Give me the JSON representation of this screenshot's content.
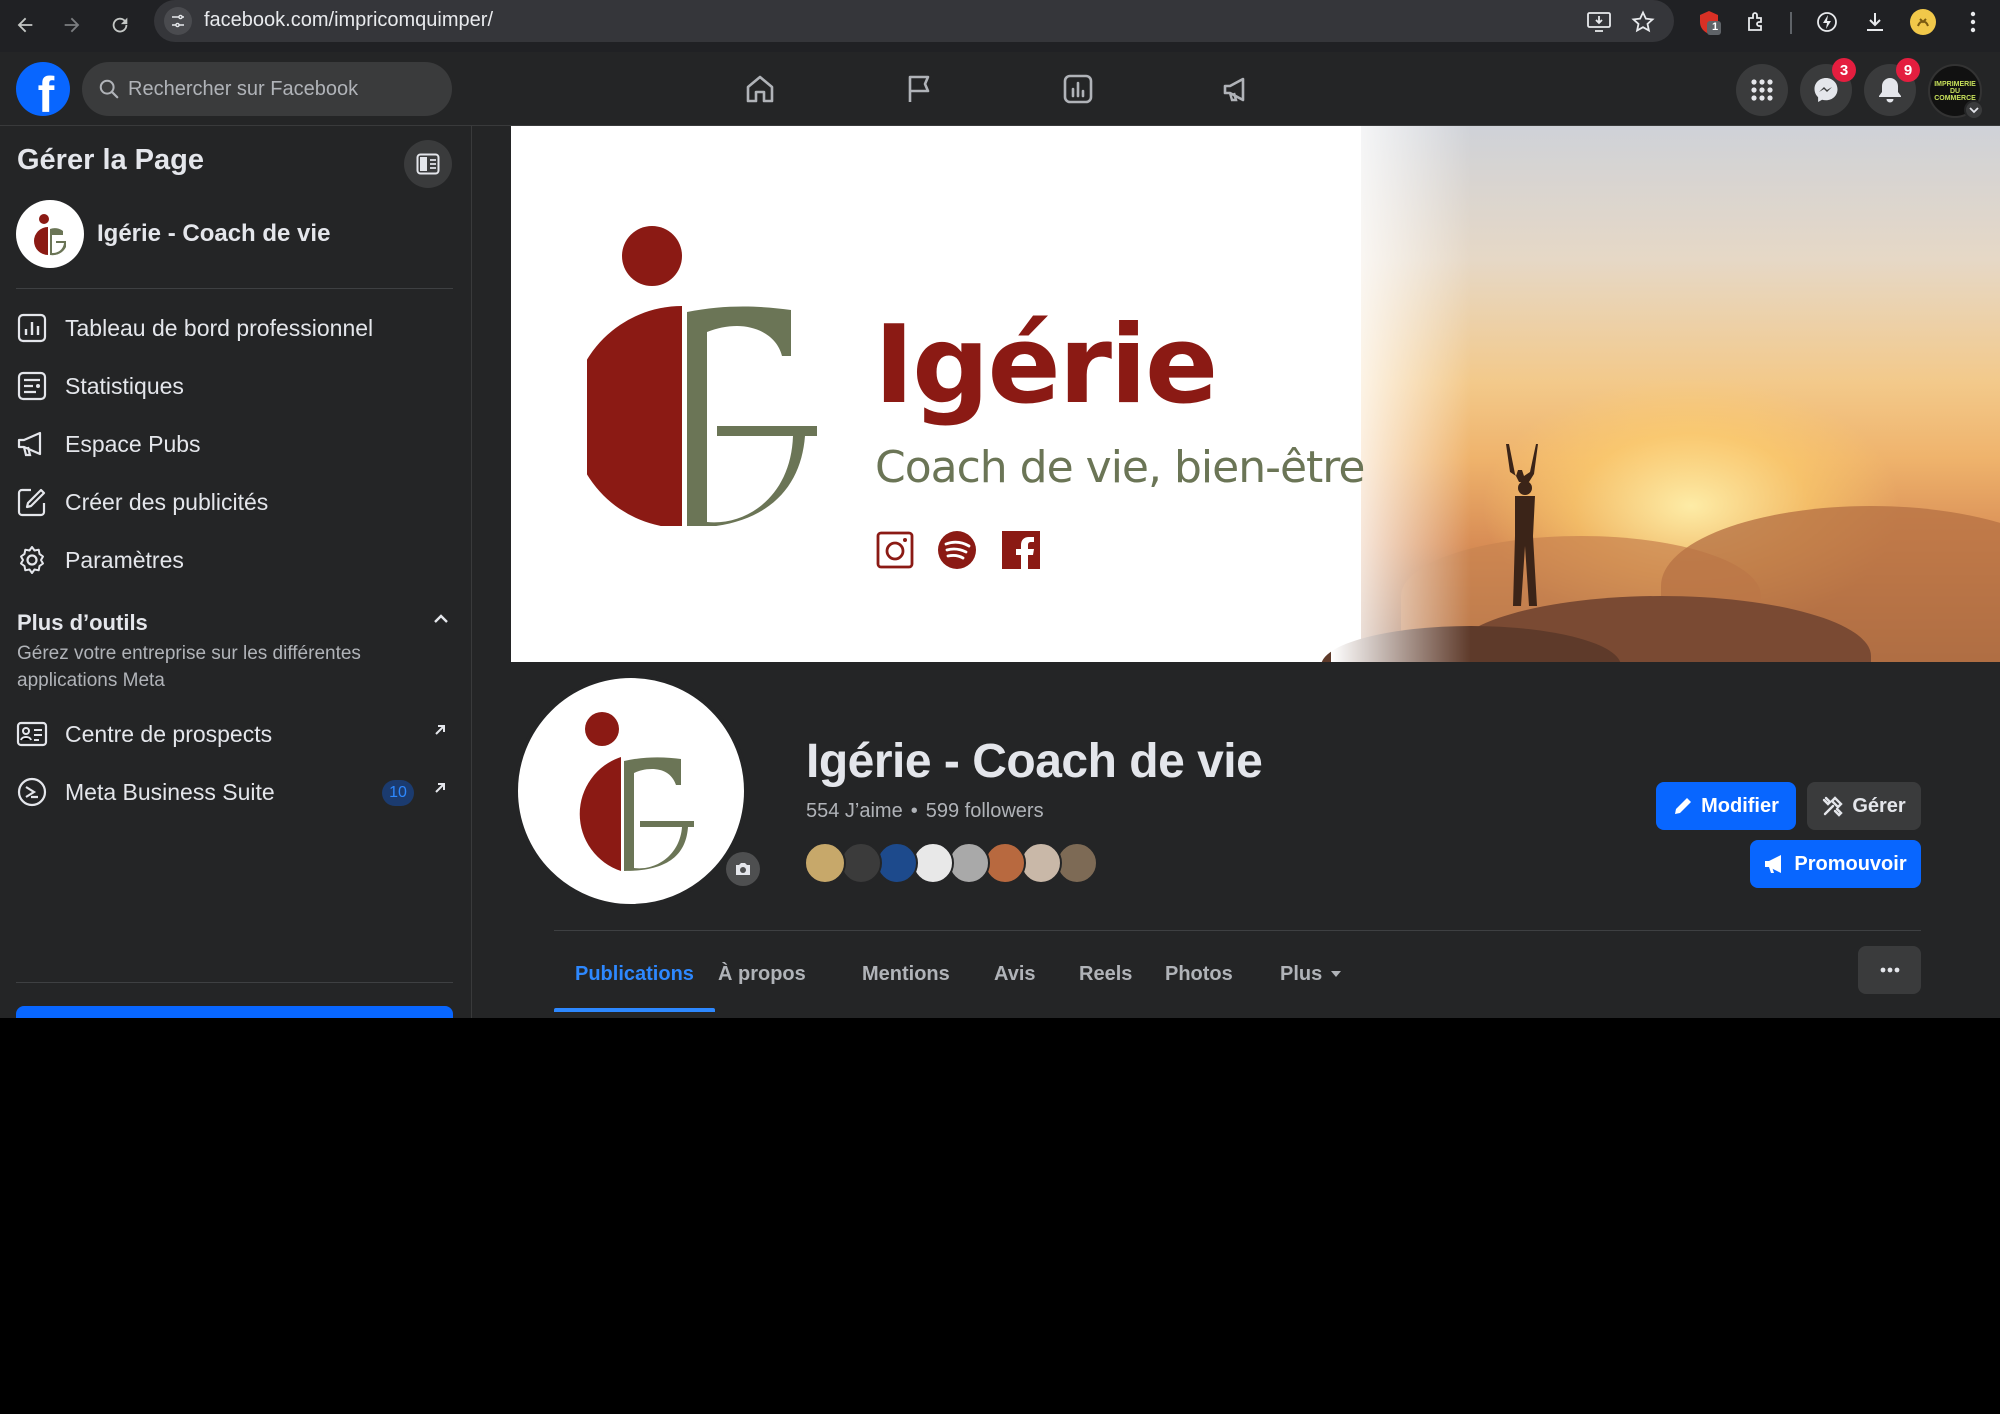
{
  "browser": {
    "url": "facebook.com/impricomquimper/",
    "extension_badge": "1"
  },
  "topbar": {
    "search_placeholder": "Rechercher sur Facebook",
    "messenger_badge": "3",
    "notifications_badge": "9",
    "account_label": "IMPRIMERIE DU COMMERCE"
  },
  "sidebar": {
    "title": "Gérer la Page",
    "page_name": "Igérie - Coach de vie",
    "items": [
      {
        "label": "Tableau de bord professionnel",
        "icon": "dashboard-icon"
      },
      {
        "label": "Statistiques",
        "icon": "insights-icon"
      },
      {
        "label": "Espace Pubs",
        "icon": "megaphone-icon"
      },
      {
        "label": "Créer des publicités",
        "icon": "edit-icon"
      },
      {
        "label": "Paramètres",
        "icon": "gear-icon"
      }
    ],
    "tools_title": "Plus d’outils",
    "tools_desc": "Gérez votre entreprise sur les différentes applications Meta",
    "tools_items": [
      {
        "label": "Centre de prospects",
        "icon": "contact-card-icon"
      },
      {
        "label": "Meta Business Suite",
        "icon": "meta-business-icon",
        "badge": "10"
      }
    ]
  },
  "cover": {
    "brand": "Igérie",
    "tagline": "Coach de vie, bien-être"
  },
  "profile": {
    "name": "Igérie - Coach de vie",
    "likes": "554 J’aime",
    "followers": "599 followers",
    "dot": "•",
    "friend_avatar_colors": [
      "#c7a86a",
      "#3b3b3b",
      "#1d4a8c",
      "#e8e8e8",
      "#a9a9a9",
      "#b8693f",
      "#c9b8a8",
      "#7d6a55"
    ],
    "buttons": {
      "edit": "Modifier",
      "manage": "Gérer",
      "promote": "Promouvoir"
    }
  },
  "tabs": [
    {
      "label": "Publications",
      "active": true
    },
    {
      "label": "À propos",
      "active": false
    },
    {
      "label": "Mentions",
      "active": false
    },
    {
      "label": "Avis",
      "active": false
    },
    {
      "label": "Reels",
      "active": false
    },
    {
      "label": "Photos",
      "active": false
    },
    {
      "label": "Plus",
      "active": false
    }
  ],
  "colors": {
    "fb_blue": "#0866ff",
    "brand_red": "#8b1a14",
    "brand_olive": "#6b7556",
    "notification_red": "#e41e3f"
  }
}
